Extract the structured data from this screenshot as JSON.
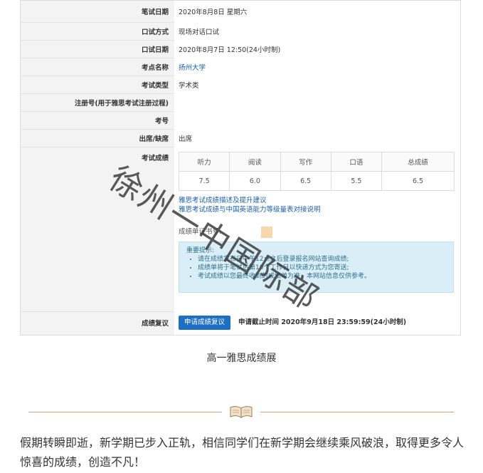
{
  "table": {
    "written_date": {
      "label": "笔试日期",
      "value": "2020年8月8日 星期六"
    },
    "speaking_mode": {
      "label": "口试方式",
      "value": "现场对话口试"
    },
    "speaking_date": {
      "label": "口试日期",
      "value": "2020年8月7日 12:50(24小时制)"
    },
    "venue": {
      "label": "考点名称",
      "value": "扬州大学"
    },
    "exam_type": {
      "label": "考试类型",
      "value": "学术类"
    },
    "reg_no": {
      "label": "注册号(用于雅思考试注册过程)",
      "value": ""
    },
    "candidate_no": {
      "label": "考号",
      "value": ""
    },
    "attendance": {
      "label": "出席/缺席",
      "value": "出席"
    },
    "scores": {
      "label": "考试成绩",
      "headers": [
        "听力",
        "阅读",
        "写作",
        "口语",
        "总成绩"
      ],
      "values": [
        "7.5",
        "6.0",
        "6.5",
        "5.5",
        "6.5"
      ],
      "links": [
        "雅思考试成绩描述及提升建议",
        "雅思考试成绩与中国英语能力等级量表对接说明"
      ],
      "certificate_label": "成绩单证书号:",
      "notice_title": "重要提示:",
      "notice_items": [
        "请在成绩发布日中午12点之后登录报名网站查询成绩;",
        "成绩单将于笔试后第10个工作日以快递方式为您寄送;",
        "考试成绩以您最终收到的成绩单为准，本网站信息仅供参考。"
      ]
    },
    "review": {
      "label": "成绩复议",
      "button": "申请成绩复议",
      "deadline": "申请截止时间 2020年9月18日 23:59:59(24小时制)"
    }
  },
  "watermark": "徐州一中国际部",
  "caption": "高一雅思成绩展",
  "paragraph": "假期转瞬即逝，新学期已步入正轨，相信同学们在新学期会继续乘风破浪，取得更多令人惊喜的成绩，创造不凡！",
  "colors": {
    "link": "#1a5fa8",
    "button": "#1d6fc4",
    "notice_bg": "#d9eef7",
    "divider": "#c8a57a"
  },
  "icons": {
    "divider_icon": "open-book-icon"
  }
}
